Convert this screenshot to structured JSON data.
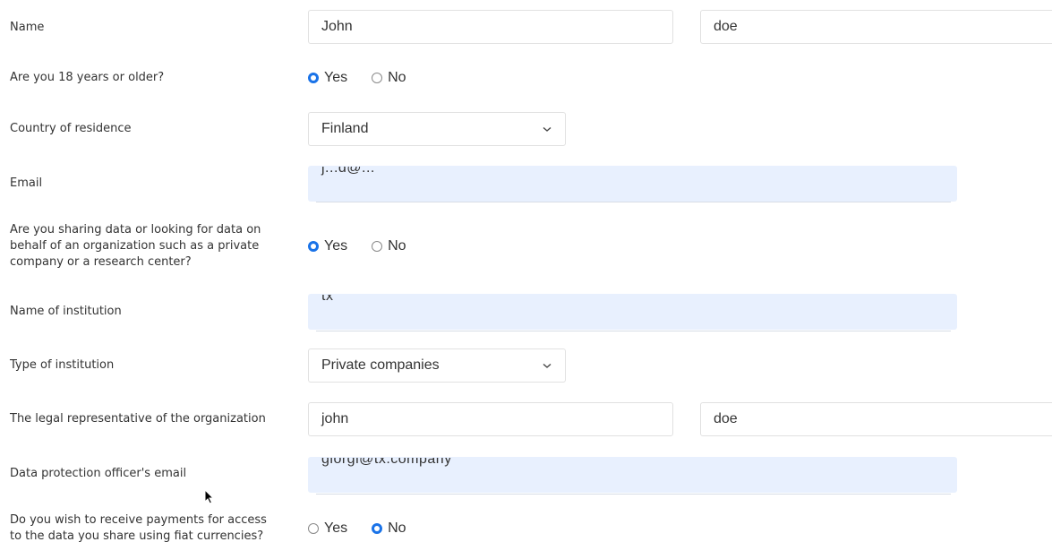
{
  "form": {
    "name": {
      "label": "Name",
      "first": "John",
      "last": "doe"
    },
    "age": {
      "label": "Are you 18 years or older?",
      "options": [
        "Yes",
        "No"
      ],
      "selected": "Yes"
    },
    "country": {
      "label": "Country of residence",
      "value": "Finland"
    },
    "email": {
      "label": "Email",
      "value": "j...d@..."
    },
    "organization": {
      "label": "Are you sharing data or looking for data on behalf of an organization such as a private company or a research center?",
      "options": [
        "Yes",
        "No"
      ],
      "selected": "Yes"
    },
    "institution_name": {
      "label": "Name of institution",
      "value": "tx"
    },
    "institution_type": {
      "label": "Type of institution",
      "value": "Private companies"
    },
    "representative": {
      "label": "The legal representative of the organization",
      "first": "john",
      "last": "doe"
    },
    "dpo_email": {
      "label": "Data protection officer's email",
      "value": "giorgi@tx.company"
    },
    "payments": {
      "label": "Do you wish to receive payments for access to the data you share using fiat currencies?",
      "options": [
        "Yes",
        "No"
      ],
      "selected": "No"
    }
  },
  "colors": {
    "autofill_bg": "#e8f0fe",
    "radio_accent": "#1a73e8",
    "border": "#e1e1e1"
  },
  "icons": {
    "select_chevron": "chevron-down-icon",
    "pointer": "mouse-cursor-icon"
  }
}
